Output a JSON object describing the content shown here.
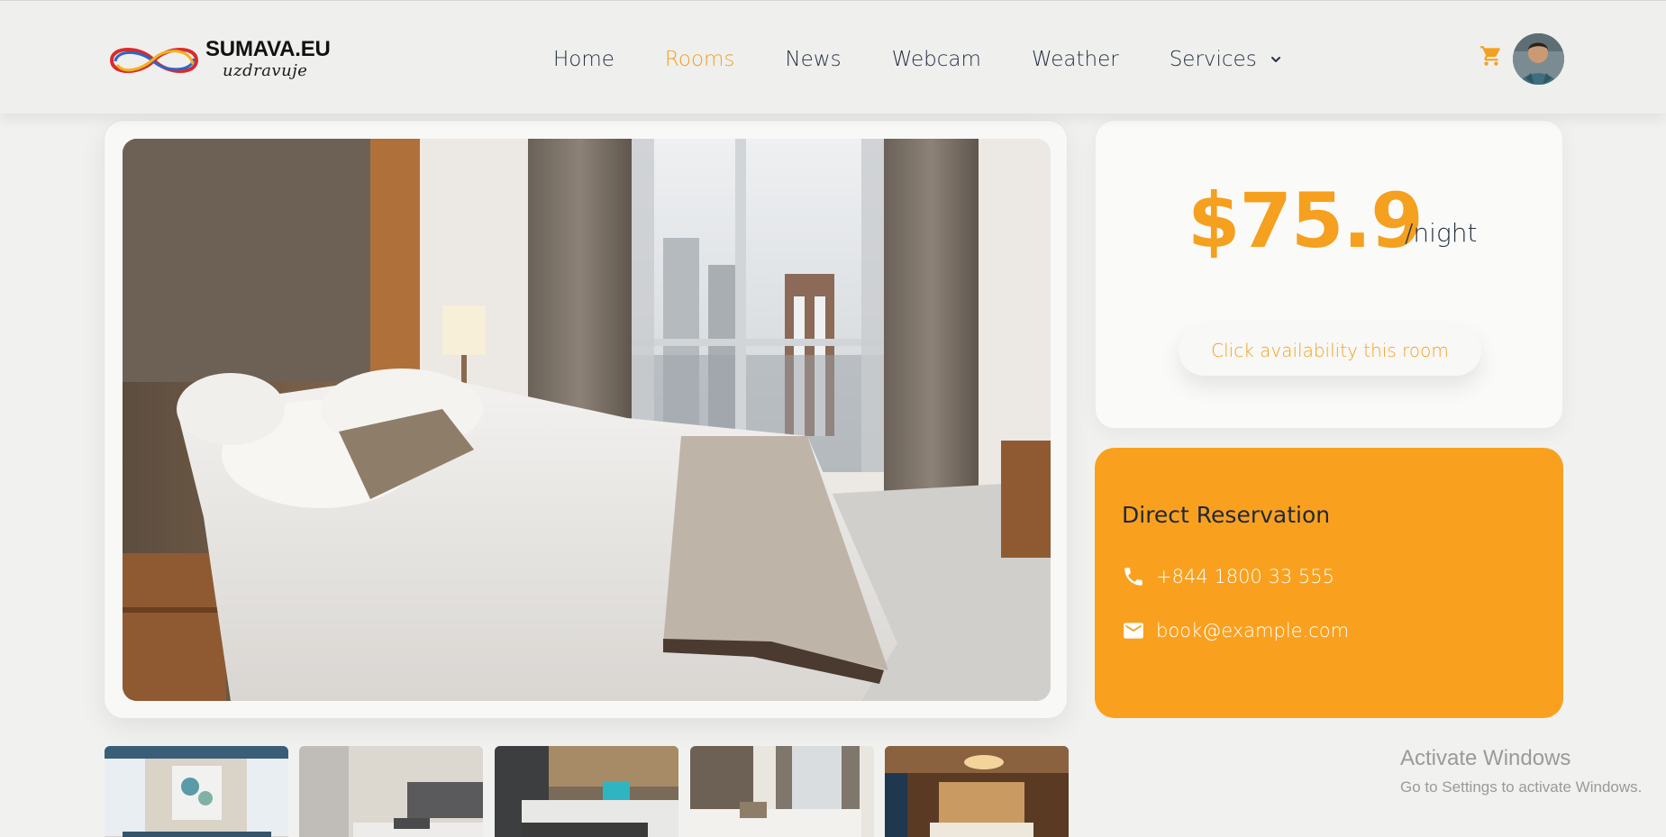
{
  "brand": {
    "name": "SUMAVA.EU",
    "tagline": "uzdravuje",
    "logo_colors": [
      "#d92b2b",
      "#2a67c9",
      "#f2b11b"
    ]
  },
  "nav": {
    "items": [
      {
        "label": "Home",
        "active": false
      },
      {
        "label": "Rooms",
        "active": true
      },
      {
        "label": "News",
        "active": false
      },
      {
        "label": "Webcam",
        "active": false
      },
      {
        "label": "Weather",
        "active": false
      },
      {
        "label": "Services",
        "active": false,
        "has_dropdown": true
      }
    ],
    "cart_icon": "cart-icon",
    "avatar_icon": "user-avatar"
  },
  "room": {
    "gallery_thumbnails": [
      "room-photo-1",
      "room-photo-2",
      "room-photo-3",
      "room-photo-4",
      "room-photo-5"
    ]
  },
  "pricing": {
    "price": "$75.9",
    "unit": "/night",
    "availability_button": "Click availability this room"
  },
  "reservation": {
    "title": "Direct Reservation",
    "phone": "+844 1800 33 555",
    "email": "book@example.com",
    "phone_icon": "phone-icon",
    "email_icon": "mail-icon"
  },
  "watermark": {
    "title": "Activate Windows",
    "subtitle": "Go to Settings to activate Windows."
  },
  "colors": {
    "accent": "#f5a01e",
    "reservation_bg": "#f9a11f",
    "text_dark": "#273244",
    "page_bg": "#f1f1f0"
  }
}
